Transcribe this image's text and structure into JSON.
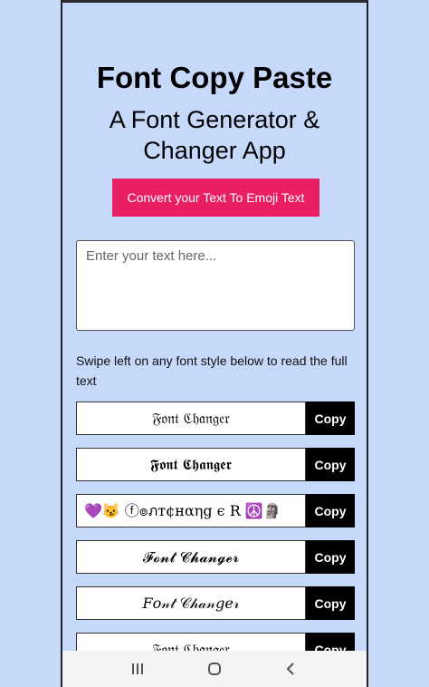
{
  "header": {
    "title": "Font Copy Paste",
    "subtitle_line1": "A Font Generator &",
    "subtitle_line2": "Changer App"
  },
  "emoji_button": {
    "label": "Convert your Text To Emoji Text"
  },
  "input": {
    "placeholder": "Enter your text here...",
    "value": ""
  },
  "hint_text": "Swipe left on any font style below to read the full text",
  "font_styles": [
    {
      "preview": "𝔉𝔬𝔫𝔱 ℭ𝔥𝔞𝔫𝔤𝔢𝔯",
      "copy_label": "Copy"
    },
    {
      "preview": "𝕱𝖔𝖓𝖙 𝕮𝖍𝖆𝖓𝖌𝖊𝖗",
      "copy_label": "Copy"
    },
    {
      "preview": "💜😼 ⓕ๏ภт¢нαηg є R ☮️🗿",
      "copy_label": "Copy"
    },
    {
      "preview": "𝓕𝓸𝓷𝓽 𝓒𝓱𝓪𝓷𝓰𝓮𝓻",
      "copy_label": "Copy"
    },
    {
      "preview": "𝐹𝑜𝓃𝓉 𝒞𝒽𝒶𝓃𝑔𝑒𝓇",
      "copy_label": "Copy"
    },
    {
      "preview": "𝔉𝔬𝔫𝔱 ℭ𝔥𝔞𝔫𝔤𝔢𝔯",
      "copy_label": "Copy"
    }
  ],
  "navbar": {
    "recents_icon": "recents-icon",
    "home_icon": "home-icon",
    "back_icon": "back-icon"
  }
}
